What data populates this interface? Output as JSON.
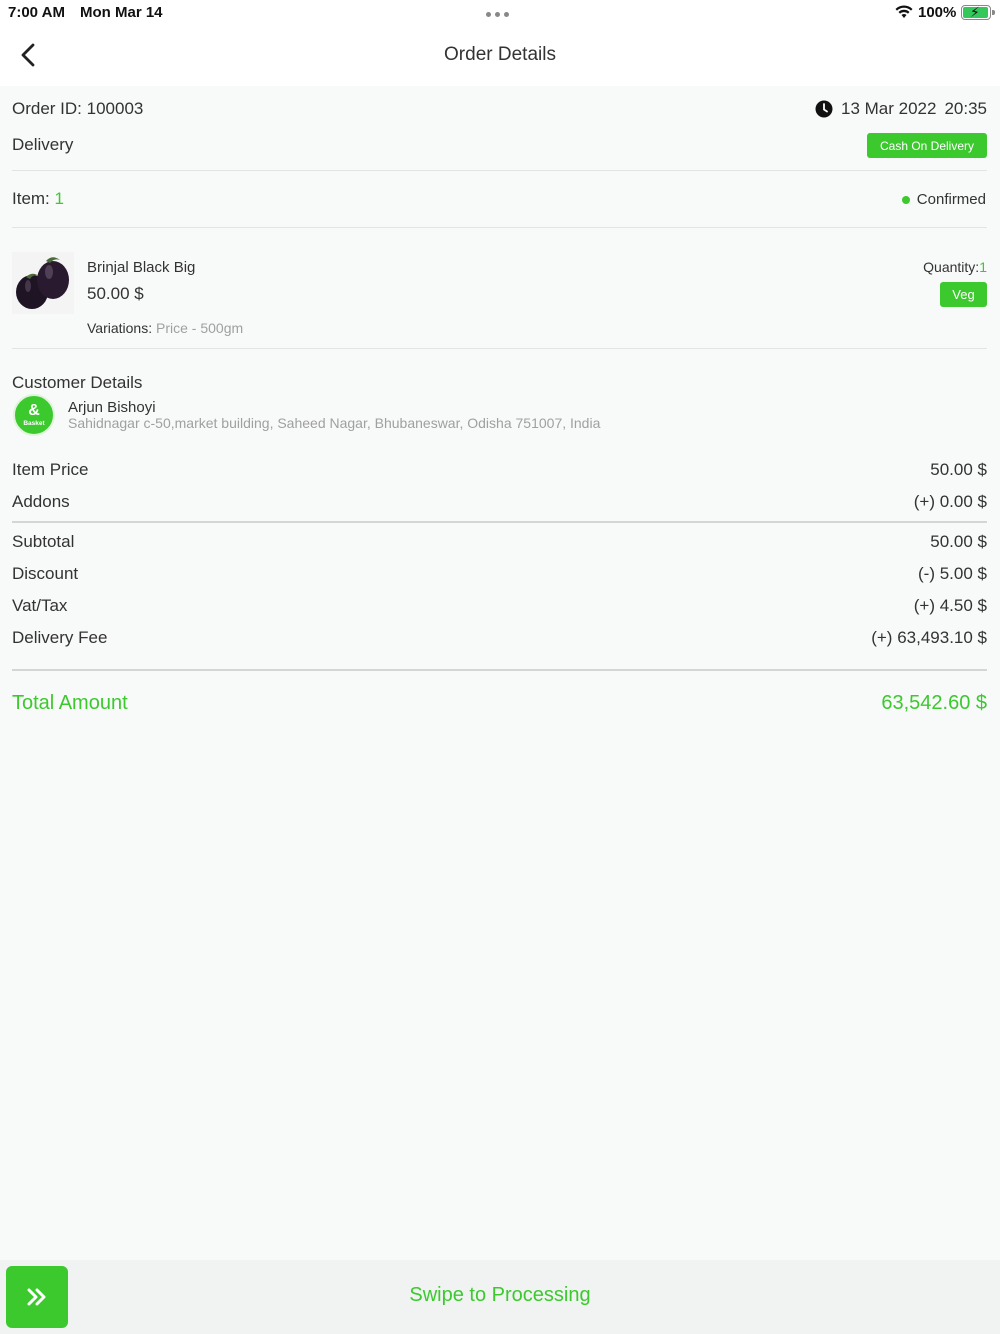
{
  "status_bar": {
    "time": "7:00 AM",
    "date": "Mon Mar 14",
    "battery": "100%",
    "battery_level": 1.0
  },
  "header": {
    "title": "Order Details"
  },
  "order": {
    "id_label": "Order ID: 100003",
    "date": "13 Mar 2022",
    "time": "20:35",
    "type": "Delivery",
    "payment_method": "Cash On Delivery",
    "item_label": "Item: ",
    "item_count": "1",
    "status": "Confirmed"
  },
  "product": {
    "name": "Brinjal Black Big",
    "price": "50.00 $",
    "variations_label": "Variations: ",
    "variations_value": "Price - 500gm",
    "quantity_label": "Quantity:",
    "quantity_value": "1",
    "tag": "Veg"
  },
  "customer": {
    "heading": "Customer Details",
    "name": "Arjun Bishoyi",
    "address": "Sahidnagar c-50,market building, Saheed Nagar, Bhubaneswar, Odisha 751007, India",
    "avatar_text": "Basket"
  },
  "pricing": {
    "item_price_label": "Item Price",
    "item_price": "50.00 $",
    "addons_label": "Addons",
    "addons": "(+) 0.00 $",
    "subtotal_label": "Subtotal",
    "subtotal": "50.00 $",
    "discount_label": "Discount",
    "discount": "(-) 5.00 $",
    "vat_label": "Vat/Tax",
    "vat": "(+) 4.50 $",
    "delivery_fee_label": "Delivery Fee",
    "delivery_fee": "(+) 63,493.10 $",
    "total_label": "Total Amount",
    "total": "63,542.60 $"
  },
  "action": {
    "swipe_label": "Swipe to Processing"
  },
  "colors": {
    "accent": "#3cc92e",
    "muted_text": "#a0a0a0"
  }
}
